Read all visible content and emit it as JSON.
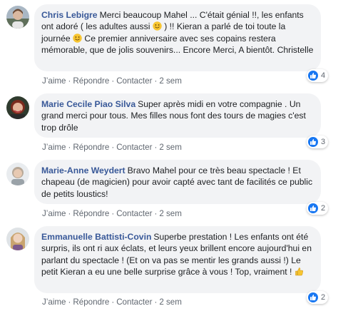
{
  "actions": {
    "like": "J’aime",
    "reply": "Répondre",
    "contact": "Contacter",
    "separator": "·"
  },
  "colors": {
    "author": "#385898",
    "bubble": "#f2f3f5",
    "muted": "#606770",
    "like_blue": "#1877f2"
  },
  "comments": [
    {
      "author": "Chris Lebigre",
      "text_parts": [
        "Merci beaucoup Mahel ... C'était génial !!, les enfants ont adoré ( les adultes aussi ",
        " ) !! Kieran a parlé de toi toute la journée ",
        " Ce premier anniversaire avec ses copains restera mémorable, que de jolis souvenirs... Encore Merci, A bientôt. Christelle"
      ],
      "emojis": [
        "smiling-face-emoji",
        "smiling-face-emoji"
      ],
      "time": "2 sem",
      "reaction_icon": "like-icon",
      "reaction_count": "4"
    },
    {
      "author": "Marie Cecile Piao Silva",
      "text": "Super après midi en votre compagnie . Un grand merci pour tous. Mes filles nous font des tours de magies c'est trop drôle",
      "time": "2 sem",
      "reaction_icon": "like-icon",
      "reaction_count": "3"
    },
    {
      "author": "Marie-Anne Weydert",
      "text": "Bravo Mahel pour ce très beau spectacle ! Et chapeau (de magicien) pour avoir capté avec tant de facilités ce public de petits loustics!",
      "time": "2 sem",
      "reaction_icon": "like-icon",
      "reaction_count": "2"
    },
    {
      "author": "Emmanuelle Battisti-Covin",
      "text_parts": [
        "Superbe prestation ! Les enfants ont été surpris, ils ont ri aux éclats, et leurs yeux brillent encore aujourd'hui en parlant du spectacle ! (Et on va pas se mentir les grands aussi !) Le petit Kieran a eu une belle surprise grâce à vous ! Top, vraiment ! "
      ],
      "emojis": [
        "thumbs-up-emoji"
      ],
      "time": "2 sem",
      "reaction_icon": "like-icon",
      "reaction_count": "2"
    }
  ]
}
